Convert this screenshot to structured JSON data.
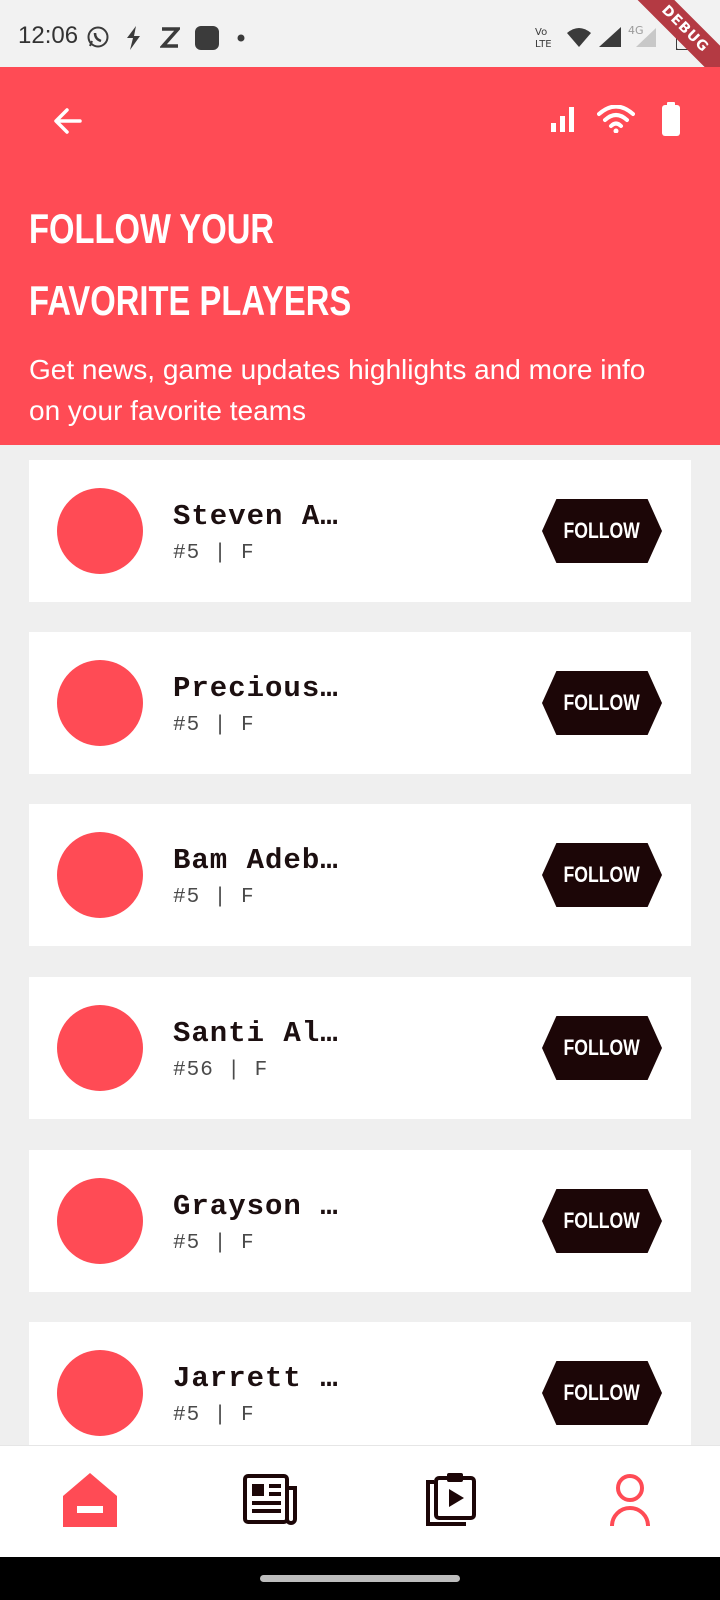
{
  "status_bar": {
    "time": "12:06",
    "debug_banner": "DEBUG",
    "icons": [
      "whatsapp-icon",
      "bolt-icon",
      "z-icon",
      "square-icon",
      "dot-icon",
      "volte-icon",
      "wifi-icon",
      "signal-icon",
      "4g-signal-icon",
      "battery-icon"
    ]
  },
  "header": {
    "title_line1": "FOLLOW YOUR",
    "title_line2": "FAVORITE PLAYERS",
    "subtitle": "Get news, game updates highlights and more info on your favorite teams",
    "icons": [
      "back-arrow-icon",
      "signal-bars-icon",
      "wifi-icon",
      "battery-icon"
    ]
  },
  "players": [
    {
      "name": "Steven A…",
      "meta": "#5 | F",
      "follow_label": "FOLLOW"
    },
    {
      "name": "Precious…",
      "meta": "#5 | F",
      "follow_label": "FOLLOW"
    },
    {
      "name": "Bam Adeb…",
      "meta": "#5 | F",
      "follow_label": "FOLLOW"
    },
    {
      "name": "Santi Al…",
      "meta": "#56 | F",
      "follow_label": "FOLLOW"
    },
    {
      "name": "Grayson …",
      "meta": "#5 | F",
      "follow_label": "FOLLOW"
    },
    {
      "name": "Jarrett …",
      "meta": "#5 | F",
      "follow_label": "FOLLOW"
    }
  ],
  "bottom_nav": {
    "items": [
      "home-icon",
      "news-icon",
      "videos-icon",
      "profile-icon"
    ],
    "active": "home-icon"
  },
  "colors": {
    "accent": "#ff4b55",
    "button_dark": "#1c0607",
    "background": "#efefef"
  }
}
